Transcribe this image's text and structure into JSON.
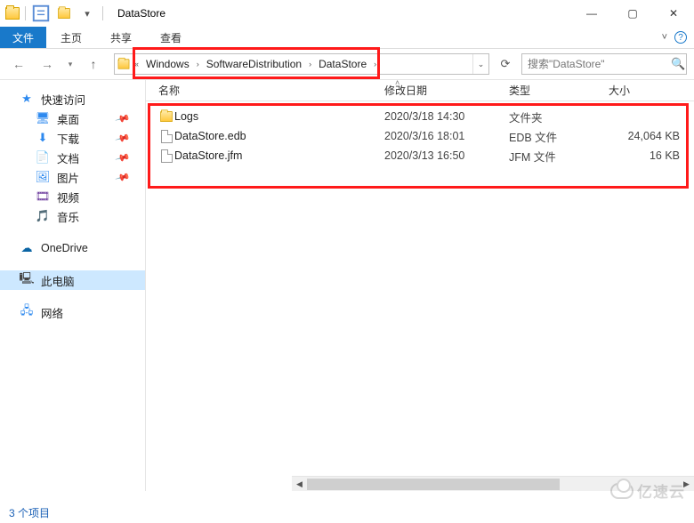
{
  "titlebar": {
    "title": "DataStore",
    "qat": {
      "props_icon": "folder-props",
      "newfolder_icon": "new-folder",
      "dropdown": "▾"
    }
  },
  "window_controls": {
    "min": "—",
    "max": "▢",
    "close": "✕"
  },
  "ribbon": {
    "file": "文件",
    "tabs": [
      "主页",
      "共享",
      "查看"
    ],
    "help_icon": "?",
    "collapse_icon": "˅"
  },
  "nav": {
    "back_icon": "←",
    "forward_icon": "→",
    "recent_icon": "▾",
    "up_icon": "↑",
    "breadcrumb_prefix": "«",
    "breadcrumbs": [
      "Windows",
      "SoftwareDistribution",
      "DataStore"
    ],
    "crumb_sep": "›",
    "addr_dropdown": "⌄",
    "refresh_icon": "⟳",
    "search_placeholder": "搜索\"DataStore\"",
    "search_icon": "🔍"
  },
  "sidebar": {
    "quick_access": {
      "label": "快速访问",
      "icon": "★"
    },
    "quick_items": [
      {
        "label": "桌面",
        "icon": "🖥",
        "pinned": true
      },
      {
        "label": "下载",
        "icon": "⬇",
        "pinned": true
      },
      {
        "label": "文档",
        "icon": "📄",
        "pinned": true
      },
      {
        "label": "图片",
        "icon": "🖼",
        "pinned": true
      },
      {
        "label": "视频",
        "icon": "🎞",
        "pinned": false
      },
      {
        "label": "音乐",
        "icon": "🎵",
        "pinned": false
      }
    ],
    "onedrive": {
      "label": "OneDrive",
      "icon": "☁"
    },
    "this_pc": {
      "label": "此电脑",
      "icon": "🖳",
      "selected": true
    },
    "network": {
      "label": "网络",
      "icon": "🖧"
    }
  },
  "columns": {
    "name": "名称",
    "date": "修改日期",
    "type": "类型",
    "size": "大小",
    "sort": "˄"
  },
  "files": [
    {
      "name": "Logs",
      "date": "2020/3/18 14:30",
      "type": "文件夹",
      "size": "",
      "kind": "folder"
    },
    {
      "name": "DataStore.edb",
      "date": "2020/3/16 18:01",
      "type": "EDB 文件",
      "size": "24,064 KB",
      "kind": "file"
    },
    {
      "name": "DataStore.jfm",
      "date": "2020/3/13 16:50",
      "type": "JFM 文件",
      "size": "16 KB",
      "kind": "file"
    }
  ],
  "status": {
    "items": "3 个项目"
  },
  "watermark": "亿速云"
}
